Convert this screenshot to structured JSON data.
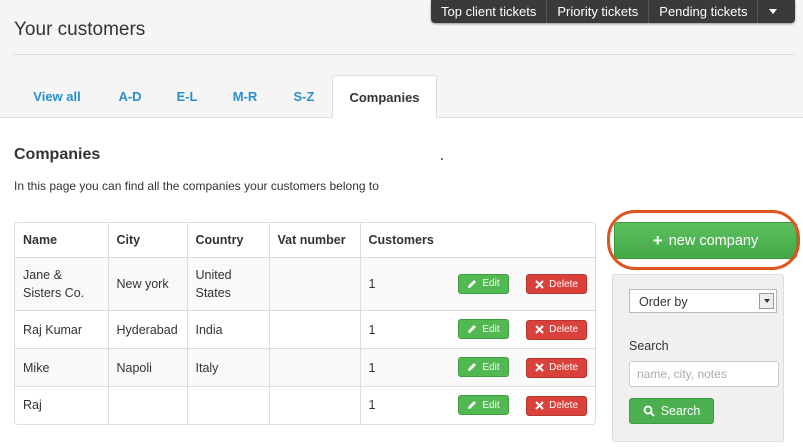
{
  "topbar": {
    "links": [
      "Top client tickets",
      "Priority tickets",
      "Pending tickets"
    ],
    "menu_icon": "caret-down-icon"
  },
  "page": {
    "title": "Your customers"
  },
  "tabs": [
    {
      "label": "View all"
    },
    {
      "label": "A-D"
    },
    {
      "label": "E-L"
    },
    {
      "label": "M-R"
    },
    {
      "label": "S-Z"
    },
    {
      "label": "Companies",
      "active": true
    }
  ],
  "section": {
    "title": "Companies",
    "intro": "In this page you can find all the companies your customers belong to"
  },
  "table": {
    "headers": [
      "Name",
      "City",
      "Country",
      "Vat number",
      "Customers"
    ],
    "rows": [
      {
        "name": "Jane & Sisters Co.",
        "city": "New york",
        "country": "United States",
        "vat": "",
        "customers": "1"
      },
      {
        "name": "Raj Kumar",
        "city": "Hyderabad",
        "country": "India",
        "vat": "",
        "customers": "1"
      },
      {
        "name": "Mike",
        "city": "Napoli",
        "country": "Italy",
        "vat": "",
        "customers": "1"
      },
      {
        "name": "Raj",
        "city": "",
        "country": "",
        "vat": "",
        "customers": "1"
      }
    ],
    "edit_label": "Edit",
    "delete_label": "Delete"
  },
  "sidebar": {
    "new_company_label": "new company",
    "order_by": "Order by",
    "search_label": "Search",
    "search_placeholder": "name, city, notes",
    "search_button": "Search"
  },
  "colors": {
    "accent_link": "#2a8fd0",
    "success": "#4cb050",
    "danger": "#d9413a",
    "highlight": "#e0531e",
    "topbar": "#3a3a3a"
  }
}
